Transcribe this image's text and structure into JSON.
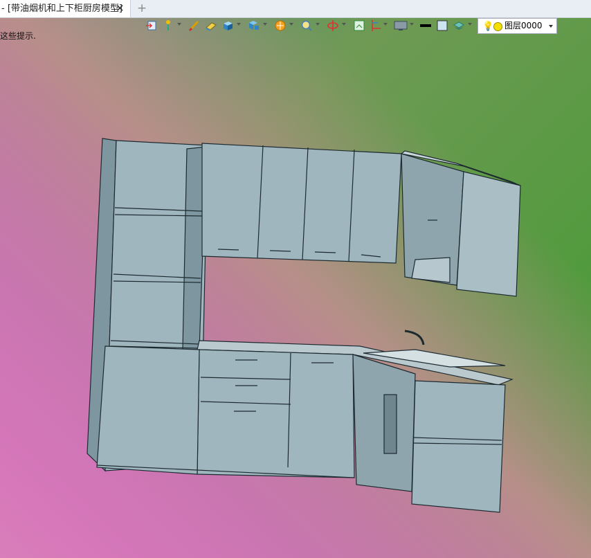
{
  "tab": {
    "title": "- [带油烟机和上下柜厨房模型]",
    "close": "✕",
    "new": "+"
  },
  "hint": "这些提示.",
  "toolbar": {
    "items": [
      "import-icon",
      "pin-icon",
      "brush-icon",
      "eraser-icon",
      "box-icon",
      "views-icon",
      "render-icon",
      "zoom-icon",
      "orbit-icon",
      "fit-icon",
      "section-icon",
      "display-icon",
      "line-color-icon",
      "fill-color-icon",
      "layers-icon"
    ],
    "layer": {
      "name": "图层0000"
    }
  },
  "colors": {
    "cabinet": "#9fb6be",
    "cabinet_dark": "#7e96a0",
    "edge": "#1c2a30"
  }
}
